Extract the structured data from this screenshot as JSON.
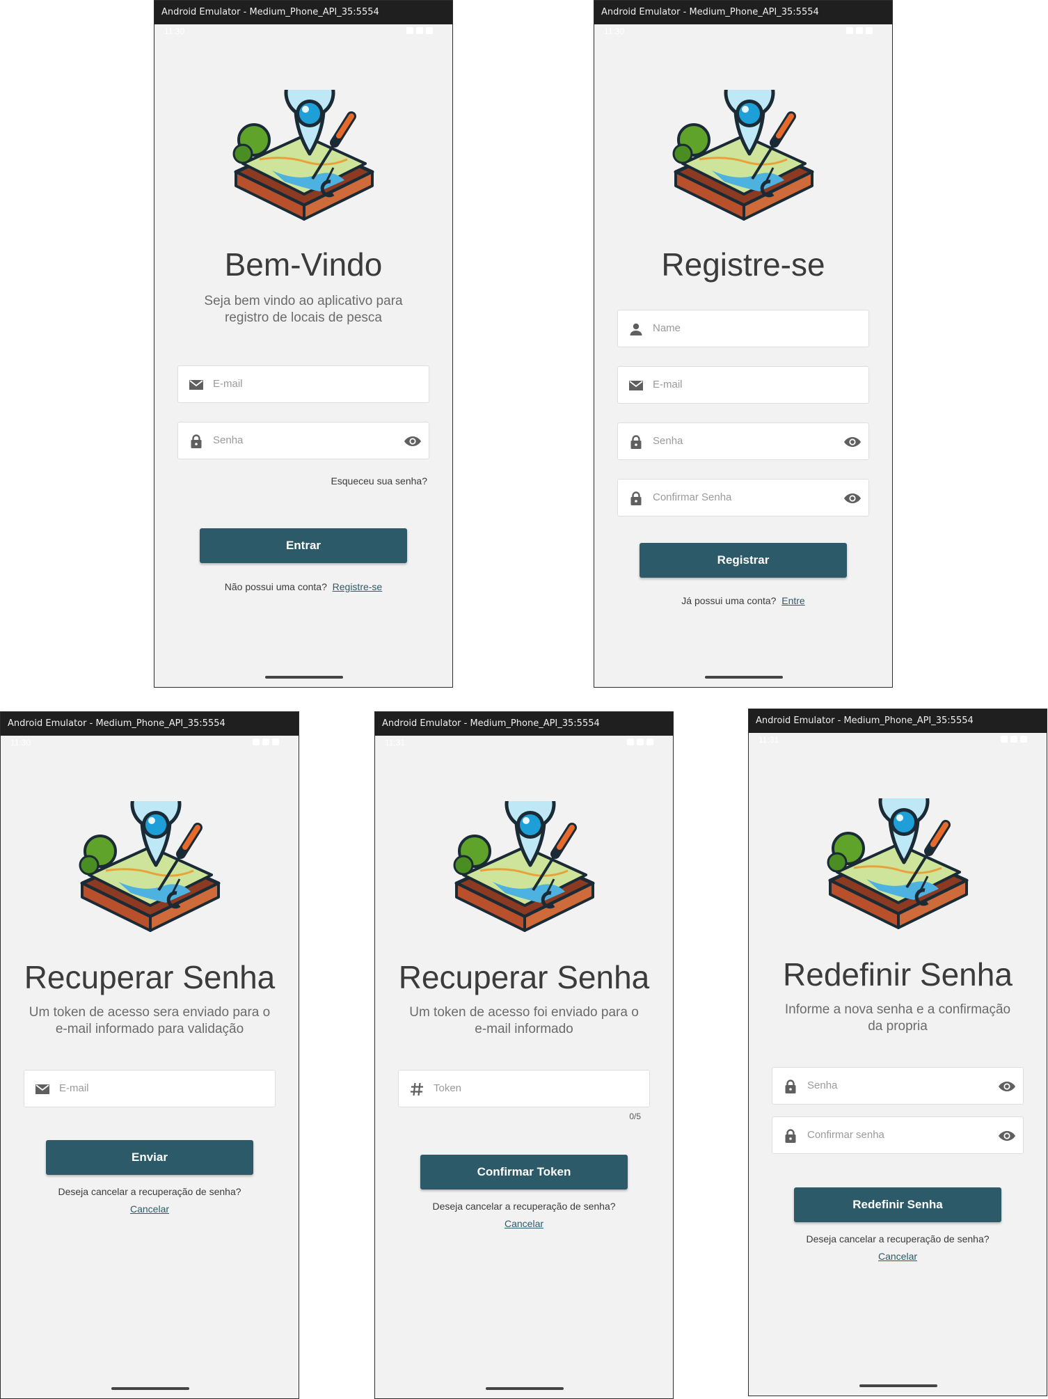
{
  "emulator_title": "Android Emulator - Medium_Phone_API_35:5554",
  "screens": {
    "login": {
      "clock": "11:30",
      "title": "Bem-Vindo",
      "subtitle": "Seja bem vindo ao aplicativo para registro de locais de pesca",
      "email_placeholder": "E-mail",
      "password_placeholder": "Senha",
      "forgot_link": "Esqueceu sua senha?",
      "submit_label": "Entrar",
      "footer_text": "Não possui uma conta?",
      "footer_link": "Registre-se"
    },
    "register": {
      "clock": "11:30",
      "title": "Registre-se",
      "name_placeholder": "Name",
      "email_placeholder": "E-mail",
      "password_placeholder": "Senha",
      "confirm_placeholder": "Confirmar Senha",
      "submit_label": "Registrar",
      "footer_text": "Já possui uma conta?",
      "footer_link": "Entre"
    },
    "recover": {
      "clock": "11:30",
      "title": "Recuperar Senha",
      "subtitle": "Um token de acesso sera enviado para o e-mail informado para validação",
      "email_placeholder": "E-mail",
      "submit_label": "Enviar",
      "cancel_text": "Deseja cancelar a recuperação de senha?",
      "cancel_link": "Cancelar"
    },
    "token": {
      "clock": "11:31",
      "title": "Recuperar Senha",
      "subtitle": "Um token de acesso foi enviado para o e-mail informado",
      "token_placeholder": "Token",
      "counter": "0/5",
      "submit_label": "Confirmar Token",
      "cancel_text": "Deseja cancelar a recuperação de senha?",
      "cancel_link": "Cancelar"
    },
    "reset": {
      "clock": "11:31",
      "title": "Redefinir Senha",
      "subtitle": "Informe a nova senha e a confirmação da propria",
      "password_placeholder": "Senha",
      "confirm_placeholder": "Confirmar senha",
      "submit_label": "Redefinir Senha",
      "cancel_text": "Deseja cancelar a recuperação de senha?",
      "cancel_link": "Cancelar"
    }
  },
  "colors": {
    "primary_button": "#2c5a68",
    "screen_background": "#f2f2f3",
    "title_text": "#3b3b3b"
  },
  "icons": [
    "app-logo-icon",
    "mail-icon",
    "lock-icon",
    "person-icon",
    "hash-icon",
    "eye-icon"
  ]
}
